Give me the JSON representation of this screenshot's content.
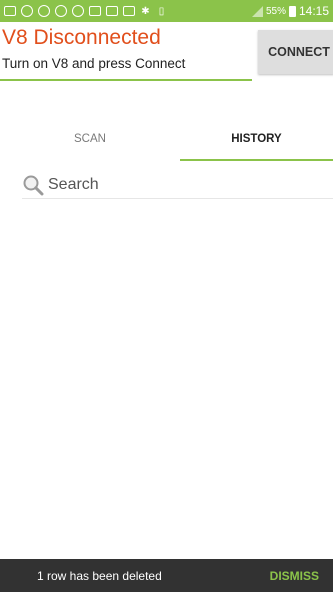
{
  "status_bar": {
    "battery_percent": "55%",
    "time": "14:15",
    "colors": {
      "background": "#8bc34a"
    }
  },
  "header": {
    "title": "V8 Disconnected",
    "subtitle": "Turn on V8 and press Connect",
    "connect_label": "CONNECT",
    "colors": {
      "title": "#e14f1c",
      "accent": "#8bc34a"
    }
  },
  "tabs": [
    {
      "label": "SCAN",
      "selected": false
    },
    {
      "label": "HISTORY",
      "selected": true
    }
  ],
  "search": {
    "placeholder": "Search",
    "value": ""
  },
  "snackbar": {
    "message": "1 row has been deleted",
    "action_label": "DISMISS",
    "colors": {
      "background": "#323232",
      "action": "#8bc34a"
    }
  }
}
